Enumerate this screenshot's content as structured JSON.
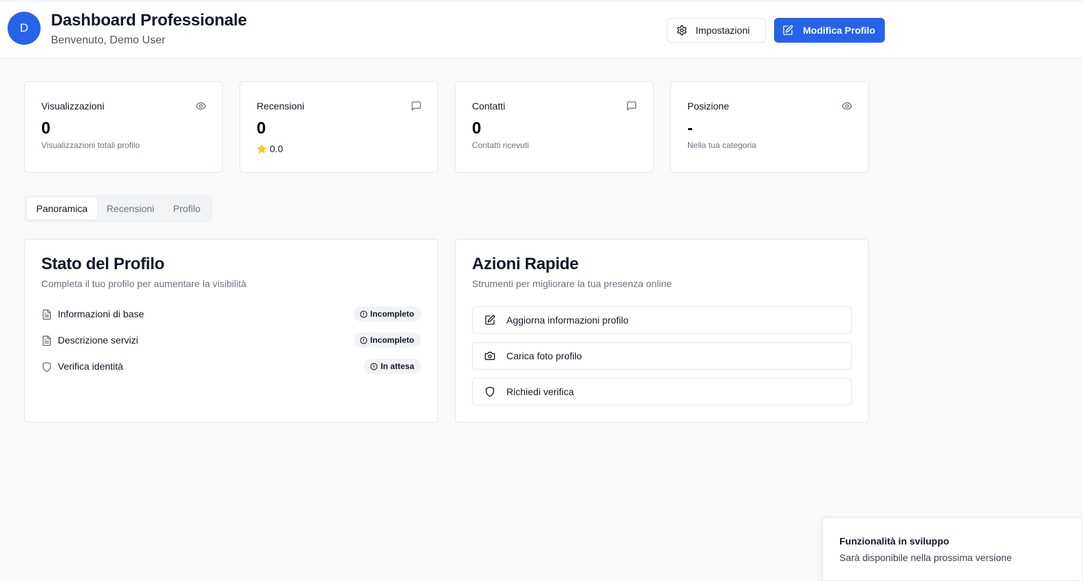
{
  "header": {
    "avatar_initial": "D",
    "title": "Dashboard Professionale",
    "subtitle": "Benvenuto, Demo User",
    "settings_label": "Impostazioni",
    "edit_label": "Modifica Profilo",
    "accent_color": "#2563eb"
  },
  "stats": [
    {
      "title": "Visualizzazioni",
      "icon": "eye-icon",
      "value": "0",
      "desc": "Visualizzazioni totali profilo"
    },
    {
      "title": "Recensioni",
      "icon": "message-square-icon",
      "value": "0",
      "rating": "0.0"
    },
    {
      "title": "Contatti",
      "icon": "message-square-icon",
      "value": "0",
      "desc": "Contatti ricevuti"
    },
    {
      "title": "Posizione",
      "icon": "eye-icon",
      "value": "-",
      "desc": "Nella tua categoria"
    }
  ],
  "tabs": [
    {
      "label": "Panoramica",
      "active": true
    },
    {
      "label": "Recensioni",
      "active": false
    },
    {
      "label": "Profilo",
      "active": false
    }
  ],
  "profile_status": {
    "title": "Stato del Profilo",
    "subtitle": "Completa il tuo profilo per aumentare la visibilità",
    "items": [
      {
        "label": "Informazioni di base",
        "icon": "file-text-icon",
        "status": "Incompleto"
      },
      {
        "label": "Descrizione servizi",
        "icon": "file-text-icon",
        "status": "Incompleto"
      },
      {
        "label": "Verifica identità",
        "icon": "shield-icon",
        "status": "In attesa"
      }
    ]
  },
  "quick_actions": {
    "title": "Azioni Rapide",
    "subtitle": "Strumenti per migliorare la tua presenza online",
    "items": [
      {
        "label": "Aggiorna informazioni profilo",
        "icon": "edit-icon"
      },
      {
        "label": "Carica foto profilo",
        "icon": "camera-icon"
      },
      {
        "label": "Richiedi verifica",
        "icon": "shield-icon"
      }
    ]
  },
  "toast": {
    "title": "Funzionalità in sviluppo",
    "description": "Sarà disponibile nella prossima versione"
  }
}
